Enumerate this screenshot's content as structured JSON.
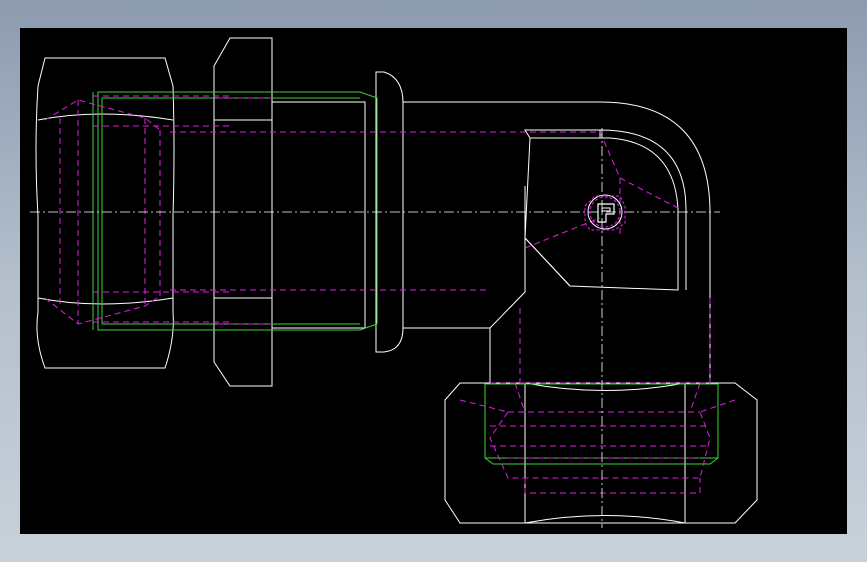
{
  "colors": {
    "viewport_background": "#000000",
    "outline": "#ffffff",
    "thread": "#3cd23c",
    "hidden_lines": "#e020e0",
    "frame_gradient_top": "#8d9bb0",
    "frame_gradient_bottom": "#c9d1da"
  },
  "icons": {
    "brand_mark": "parker-logo-icon"
  }
}
